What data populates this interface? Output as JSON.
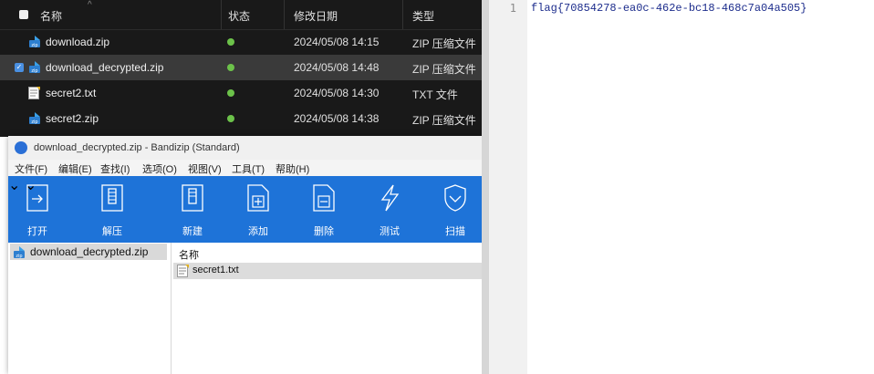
{
  "explorer": {
    "columns": {
      "name": "名称",
      "status": "状态",
      "modified": "修改日期",
      "type": "类型"
    },
    "files": [
      {
        "name": "download.zip",
        "date": "2024/05/08 14:15",
        "type": "ZIP 压缩文件",
        "icon": "zip-icon"
      },
      {
        "name": "download_decrypted.zip",
        "date": "2024/05/08 14:48",
        "type": "ZIP 压缩文件",
        "icon": "zip-icon",
        "selected": true
      },
      {
        "name": "secret2.txt",
        "date": "2024/05/08 14:30",
        "type": "TXT 文件",
        "icon": "text-file-icon"
      },
      {
        "name": "secret2.zip",
        "date": "2024/05/08 14:38",
        "type": "ZIP 压缩文件",
        "icon": "zip-icon"
      }
    ],
    "status_color": "#6cc24a"
  },
  "bandizip": {
    "title": "download_decrypted.zip - Bandizip (Standard)",
    "menu": [
      "文件(F)",
      "编辑(E)",
      "查找(I)",
      "选项(O)",
      "视图(V)",
      "工具(T)",
      "帮助(H)"
    ],
    "toolbar": [
      "打开",
      "解压",
      "新建",
      "添加",
      "删除",
      "测试",
      "扫描"
    ],
    "toolbar_color": "#1e73d8",
    "tree_item": "download_decrypted.zip",
    "column_name": "名称",
    "file": "secret1.txt"
  },
  "editor": {
    "line_number": "1",
    "content": "flag{70854278-ea0c-462e-bc18-468c7a04a505}"
  }
}
